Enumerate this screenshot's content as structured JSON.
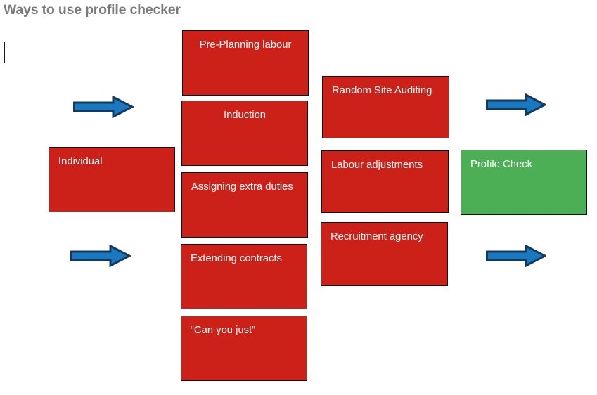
{
  "page": {
    "title": "Ways to use profile checker",
    "title_color": "#7b7b7b",
    "background": "#ffffff"
  },
  "colors": {
    "red_box": "#cc2118",
    "green_box": "#4cae55",
    "box_border": "#0d0d0d",
    "box_text": "#ffffff",
    "arrow_fill": "#1879c0",
    "arrow_outline": "#15395c"
  },
  "diagram": {
    "type": "flow-diagram",
    "source_nodes": [
      {
        "id": "individual",
        "label": "Individual",
        "color": "red",
        "align": "left"
      }
    ],
    "middle_nodes": [
      {
        "id": "pre-planning-labour",
        "label": "Pre-Planning labour",
        "color": "red",
        "align": "center"
      },
      {
        "id": "induction",
        "label": "Induction",
        "color": "red",
        "align": "center"
      },
      {
        "id": "assigning-extra-duties",
        "label": "Assigning extra duties",
        "color": "red",
        "align": "left"
      },
      {
        "id": "extending-contracts",
        "label": "Extending contracts",
        "color": "red",
        "align": "left"
      },
      {
        "id": "can-you-just",
        "label": "“Can you just”",
        "color": "red",
        "align": "left"
      }
    ],
    "right_nodes": [
      {
        "id": "random-site-auditing",
        "label": "Random Site Auditing",
        "color": "red",
        "align": "left"
      },
      {
        "id": "labour-adjustments",
        "label": "Labour adjustments",
        "color": "red",
        "align": "left"
      },
      {
        "id": "recruitment-agency",
        "label": "Recruitment agency",
        "color": "red",
        "align": "left"
      }
    ],
    "outcome_nodes": [
      {
        "id": "profile-check",
        "label": "Profile Check",
        "color": "green",
        "align": "left"
      }
    ],
    "arrows": [
      {
        "id": "arrow-left-top",
        "direction": "right"
      },
      {
        "id": "arrow-left-bottom",
        "direction": "right"
      },
      {
        "id": "arrow-right-top",
        "direction": "right"
      },
      {
        "id": "arrow-right-bottom",
        "direction": "right"
      }
    ]
  }
}
